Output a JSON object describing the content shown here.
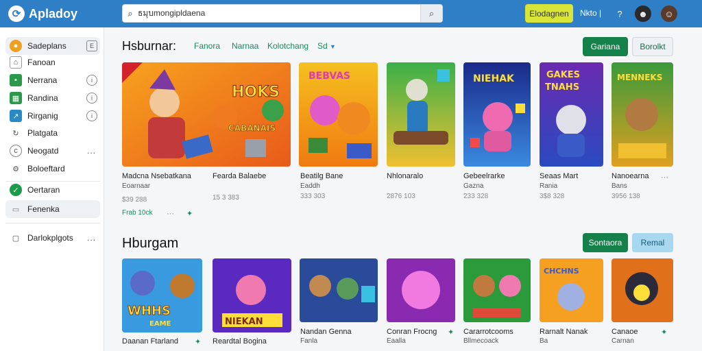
{
  "app": {
    "title": "Apladoy"
  },
  "search": {
    "value": "ธมุบmongipldaena"
  },
  "topbar": {
    "action_label": "Elodagnen",
    "link_label": "Nkto |"
  },
  "colors": {
    "topbar": "#2f7fc6",
    "accent_green": "#14804a",
    "action_yellow": "#d8e436",
    "filter_green": "#1a8a5a"
  },
  "sidebar": {
    "items": [
      {
        "label": "Sadeplans",
        "icon": "coin-icon",
        "trail": "E"
      },
      {
        "label": "Fanoan",
        "icon": "home-icon",
        "trail": ""
      },
      {
        "label": "Nerrana",
        "icon": "square-icon",
        "trail": "i"
      },
      {
        "label": "Randina",
        "icon": "grid-icon",
        "trail": "i"
      },
      {
        "label": "Rirganig",
        "icon": "chart-icon",
        "trail": "i"
      },
      {
        "label": "Platgata",
        "icon": "refresh-icon",
        "trail": ""
      },
      {
        "label": "Neogatd",
        "icon": "circle-icon",
        "trail": "..."
      },
      {
        "label": "Boloeftard",
        "icon": "gear-icon",
        "trail": ""
      },
      {
        "label": "Oertaran",
        "icon": "check-icon",
        "trail": ""
      },
      {
        "label": "Fenenka",
        "icon": "folder-icon",
        "trail": ""
      },
      {
        "label": "Darlokplgots",
        "icon": "file-icon",
        "trail": "..."
      }
    ]
  },
  "section1": {
    "title": "Hsburnar:",
    "filters": [
      "Fanora",
      "Narnaa",
      "Kolotchang",
      "Sd"
    ],
    "buttons": {
      "primary": "Gariana",
      "secondary": "Borolkt"
    },
    "cards": [
      {
        "title": "Madcna  Nsebatkana",
        "sub": "Eoarnaar",
        "meta": "$39 288",
        "extra": "Frab 10ck"
      },
      {
        "title": "Fearda Balaebe",
        "sub": "",
        "meta": "15 3 383",
        "extra": ""
      },
      {
        "title": "Beatilg Bane",
        "sub": "Eaddh",
        "meta": "333 303",
        "extra": ""
      },
      {
        "title": "Nhlonaralo",
        "sub": "",
        "meta": "2876 103",
        "extra": ""
      },
      {
        "title": "Gebeelrarke",
        "sub": "Gazna",
        "meta": "233 328",
        "extra": ""
      },
      {
        "title": "Seaas Mart",
        "sub": "Rania",
        "meta": "3$8 328",
        "extra": ""
      },
      {
        "title": "Nanoearna",
        "sub": "Bans",
        "meta": "3956 138",
        "extra": ""
      }
    ]
  },
  "section2": {
    "title": "Hburgam",
    "buttons": {
      "primary": "Sontaora",
      "secondary": "Remal"
    },
    "cards": [
      {
        "title": "Daanan Ftarland",
        "sub": ""
      },
      {
        "title": "Reardtal Bogina",
        "sub": ""
      },
      {
        "title": "Nandan Genna",
        "sub": "Fanla"
      },
      {
        "title": "Conran Frocng",
        "sub": "Eaalla"
      },
      {
        "title": "Cararrotcooms",
        "sub": "Bllmecoack"
      },
      {
        "title": "Rarnalt Nanak",
        "sub": "Ba"
      },
      {
        "title": "Canaoe",
        "sub": "Carnan"
      }
    ]
  }
}
